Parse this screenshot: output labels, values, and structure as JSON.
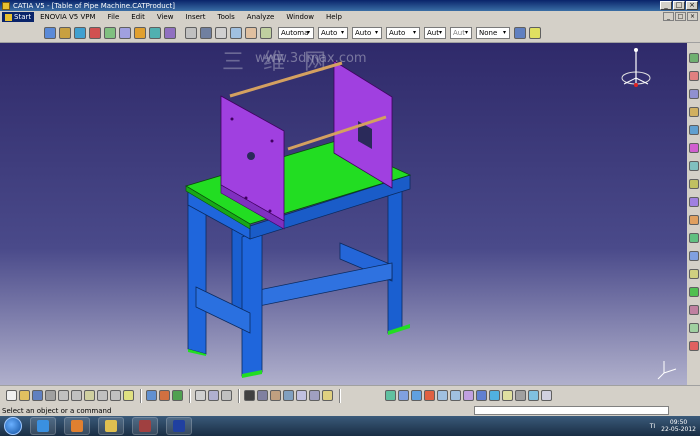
{
  "window": {
    "title": "CATIA V5 - [Table of Pipe Machine.CATProduct]",
    "buttons": [
      "_",
      "□",
      "×"
    ]
  },
  "menu": {
    "start": "Start",
    "items": [
      "ENOVIA V5 VPM",
      "File",
      "Edit",
      "View",
      "Insert",
      "Tools",
      "Analyze",
      "Window",
      "Help"
    ]
  },
  "toolbar": {
    "combos": [
      "Automa",
      "Auto",
      "Auto",
      "Auto",
      "Aut",
      "Aut",
      "None"
    ]
  },
  "watermark": {
    "big": "三 维 网",
    "url": "www.3dmax.com"
  },
  "status": {
    "message": "Select an object or a command"
  },
  "taskbar": {
    "lang": "TI",
    "time": "09:50",
    "date": "22-05-2012"
  },
  "colors": {
    "viewport_top": "#2f2a6a",
    "table_top": "#22dd22",
    "frame": "#1a5fd0",
    "plate": "#a040e0",
    "rod": "#d4a060"
  }
}
